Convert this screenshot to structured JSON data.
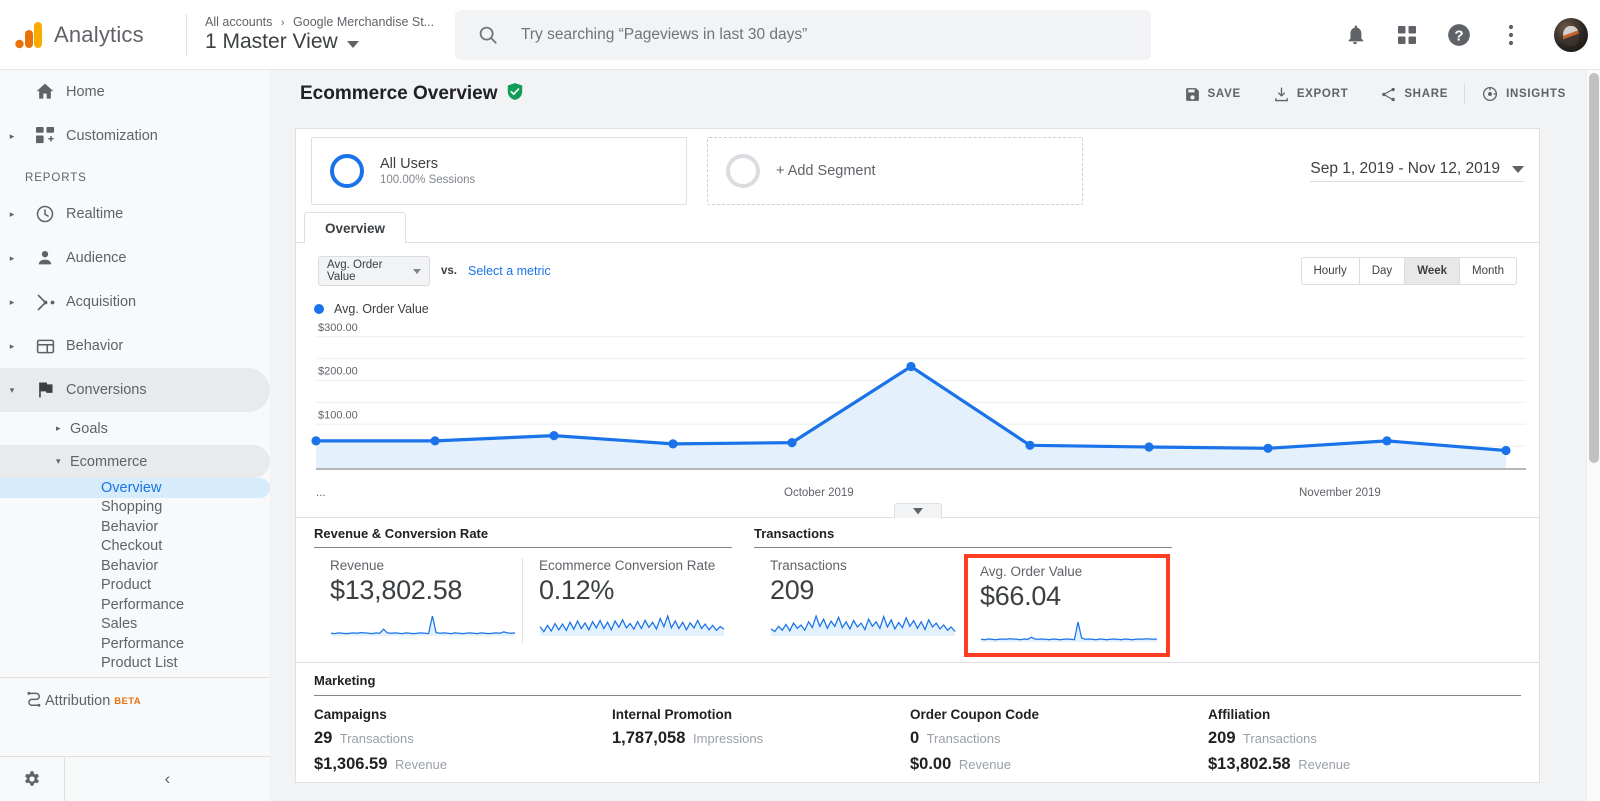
{
  "header": {
    "brand": "Analytics",
    "breadcrumb_all": "All accounts",
    "breadcrumb_sep": "›",
    "breadcrumb_account": "Google Merchandise St...",
    "view_name": "1 Master View",
    "search_placeholder": "Try searching “Pageviews in last 30 days”",
    "icons": {
      "search": "search-icon",
      "bell": "notifications-bell-icon",
      "apps": "apps-grid-icon",
      "help": "help-question-icon",
      "more": "more-vertical-icon",
      "avatar": "user-avatar"
    }
  },
  "sidebar": {
    "section_label": "REPORTS",
    "items": [
      {
        "label": "Home",
        "icon": "home-icon",
        "expandable": false
      },
      {
        "label": "Customization",
        "icon": "customization-icon",
        "expandable": true
      },
      {
        "label": "Realtime",
        "icon": "clock-icon",
        "expandable": true
      },
      {
        "label": "Audience",
        "icon": "person-icon",
        "expandable": true
      },
      {
        "label": "Acquisition",
        "icon": "acquisition-nodes-icon",
        "expandable": true
      },
      {
        "label": "Behavior",
        "icon": "behavior-layout-icon",
        "expandable": true
      },
      {
        "label": "Conversions",
        "icon": "flag-icon",
        "expandable": true,
        "expanded": true,
        "active": true
      }
    ],
    "sub_items": [
      {
        "label": "Goals",
        "expanded": false
      },
      {
        "label": "Ecommerce",
        "expanded": true,
        "active": true
      }
    ],
    "leaves": [
      {
        "label": "Overview",
        "selected": true
      },
      {
        "label": "Shopping",
        "selected": false
      },
      {
        "label": "Behavior",
        "selected": false
      },
      {
        "label": "Checkout",
        "selected": false
      },
      {
        "label": "Behavior",
        "selected": false
      },
      {
        "label": "Product",
        "selected": false
      },
      {
        "label": "Performance",
        "selected": false
      },
      {
        "label": "Sales",
        "selected": false
      },
      {
        "label": "Performance",
        "selected": false
      },
      {
        "label": "Product List",
        "selected": false
      }
    ],
    "attribution": {
      "label": "Attribution",
      "badge": "BETA",
      "icon": "attribution-icon"
    },
    "footer": {
      "gear_icon": "gear-icon",
      "collapse_icon": "chevron-left-icon"
    }
  },
  "page": {
    "title": "Ecommerce Overview",
    "verified_icon": "verified-shield-icon",
    "actions": [
      {
        "label": "SAVE",
        "icon": "save-disk-icon"
      },
      {
        "label": "EXPORT",
        "icon": "download-icon"
      },
      {
        "label": "SHARE",
        "icon": "share-icon"
      },
      {
        "label": "INSIGHTS",
        "icon": "insights-icon"
      }
    ]
  },
  "segments": {
    "all_users": {
      "title": "All Users",
      "subtitle": "100.00% Sessions"
    },
    "add_segment": {
      "label": "+ Add Segment"
    },
    "date_range": "Sep 1, 2019 - Nov 12, 2019"
  },
  "tabs": [
    {
      "label": "Overview",
      "active": true
    }
  ],
  "chart_controls": {
    "metric_selected": "Avg. Order Value",
    "vs_label": "vs.",
    "select_metric_link": "Select a metric",
    "granularity": [
      {
        "label": "Hourly",
        "selected": false
      },
      {
        "label": "Day",
        "selected": false
      },
      {
        "label": "Week",
        "selected": true
      },
      {
        "label": "Month",
        "selected": false
      }
    ],
    "legend": "Avg. Order Value",
    "legend_color": "#1a73e8",
    "collapse_icon": "chevron-down-icon"
  },
  "chart_data": {
    "type": "area",
    "title": "Avg. Order Value",
    "xlabel": "",
    "ylabel": "Avg. Order Value",
    "ylim": [
      0,
      320
    ],
    "yticks": [
      100,
      200,
      300
    ],
    "ytick_labels": [
      "$100.00",
      "$200.00",
      "$300.00"
    ],
    "grid": true,
    "legend_position": "top-left",
    "x_axis_labels": [
      {
        "text": "...",
        "position": 0.0
      },
      {
        "text": "October 2019",
        "position": 0.435
      },
      {
        "text": "November 2019",
        "position": 0.845
      }
    ],
    "series": [
      {
        "name": "Avg. Order Value",
        "color": "#1a73e8",
        "fill": "#e4f0fb",
        "values": [
          62,
          62,
          74,
          55,
          58,
          232,
          52,
          48,
          45,
          62,
          40
        ]
      }
    ],
    "x": [
      "Sep 1, 2019",
      "Sep 8, 2019",
      "Sep 15, 2019",
      "Sep 22, 2019",
      "Sep 29, 2019",
      "Oct 6, 2019",
      "Oct 13, 2019",
      "Oct 20, 2019",
      "Oct 27, 2019",
      "Nov 3, 2019",
      "Nov 10, 2019"
    ]
  },
  "panels": [
    {
      "group": "Revenue & Conversion Rate",
      "cells": [
        {
          "label": "Revenue",
          "value": "$13,802.58",
          "highlight": false,
          "sparkline": [
            8,
            7,
            9,
            8,
            7,
            8,
            9,
            8,
            10,
            9,
            8,
            7,
            9,
            8,
            20,
            9,
            8,
            9,
            8,
            7,
            9,
            8,
            7,
            8,
            9,
            8,
            7,
            58,
            10,
            8,
            9,
            8,
            7,
            9,
            8,
            7,
            8,
            9,
            8,
            7,
            9,
            8,
            7,
            8,
            9,
            8,
            12,
            9,
            8,
            9
          ]
        },
        {
          "label": "Ecommerce Conversion Rate",
          "value": "0.12%",
          "highlight": false,
          "sparkline": [
            30,
            14,
            34,
            16,
            40,
            20,
            38,
            18,
            44,
            22,
            48,
            24,
            42,
            20,
            46,
            26,
            50,
            24,
            44,
            20,
            48,
            28,
            52,
            26,
            40,
            22,
            46,
            24,
            50,
            28,
            44,
            22,
            56,
            30,
            64,
            26,
            48,
            24,
            44,
            20,
            42,
            26,
            50,
            24,
            38,
            20,
            34,
            18,
            30,
            22
          ]
        }
      ]
    },
    {
      "group": "Transactions",
      "cells": [
        {
          "label": "Transactions",
          "value": "209",
          "highlight": false,
          "sparkline": [
            22,
            14,
            30,
            18,
            36,
            16,
            40,
            24,
            34,
            18,
            44,
            26,
            62,
            30,
            52,
            24,
            46,
            30,
            58,
            26,
            44,
            22,
            48,
            28,
            40,
            20,
            52,
            30,
            44,
            24,
            60,
            28,
            50,
            22,
            42,
            26,
            56,
            30,
            48,
            24,
            44,
            20,
            50,
            28,
            40,
            22,
            34,
            18,
            28,
            14
          ]
        },
        {
          "label": "Avg. Order Value",
          "value": "$66.04",
          "highlight": true,
          "highlight_color": "#fc3d21",
          "sparkline": [
            8,
            7,
            9,
            8,
            7,
            8,
            9,
            8,
            10,
            9,
            8,
            7,
            9,
            8,
            14,
            9,
            8,
            9,
            8,
            7,
            9,
            8,
            7,
            8,
            9,
            8,
            7,
            60,
            12,
            8,
            9,
            8,
            7,
            9,
            8,
            7,
            8,
            9,
            8,
            7,
            9,
            8,
            7,
            8,
            9,
            8,
            10,
            9,
            8,
            9
          ]
        }
      ]
    }
  ],
  "marketing": {
    "group": "Marketing",
    "columns": [
      {
        "name": "Campaigns",
        "rows": [
          {
            "value": "29",
            "label": "Transactions"
          },
          {
            "value": "$1,306.59",
            "label": "Revenue"
          }
        ]
      },
      {
        "name": "Internal Promotion",
        "rows": [
          {
            "value": "1,787,058",
            "label": "Impressions"
          }
        ]
      },
      {
        "name": "Order Coupon Code",
        "rows": [
          {
            "value": "0",
            "label": "Transactions"
          },
          {
            "value": "$0.00",
            "label": "Revenue"
          }
        ]
      },
      {
        "name": "Affiliation",
        "rows": [
          {
            "value": "209",
            "label": "Transactions"
          },
          {
            "value": "$13,802.58",
            "label": "Revenue"
          }
        ]
      }
    ]
  },
  "colors": {
    "accent_blue": "#1a73e8",
    "brand_orange": "#e8710a",
    "highlight_red": "#fc3d21",
    "verified_green": "#0f9d58"
  }
}
